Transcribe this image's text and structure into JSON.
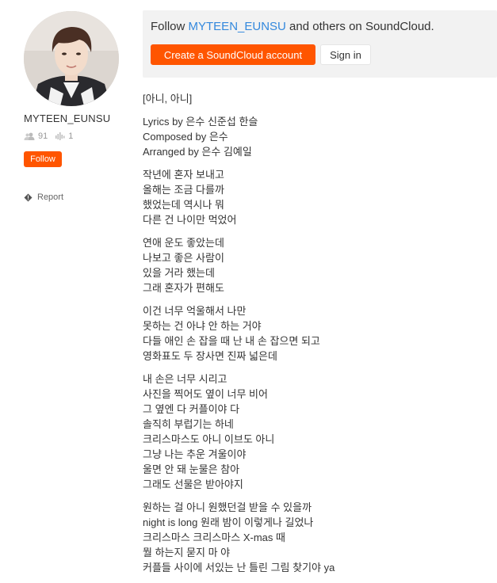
{
  "profile": {
    "username": "MYTEEN_EUNSU",
    "followers": "91",
    "tracks": "1",
    "follow_label": "Follow",
    "report_label": "Report"
  },
  "banner": {
    "prefix": "Follow ",
    "user": "MYTEEN_EUNSU",
    "suffix": " and others on SoundCloud.",
    "create_label": "Create a SoundCloud account",
    "signin_label": "Sign in"
  },
  "colors": {
    "accent": "#ff5500",
    "link": "#3388dd",
    "banner_bg": "#f2f2f2"
  },
  "icons": [
    "followers-icon",
    "tracks-icon",
    "report-flag-icon"
  ],
  "description": [
    [
      "[아니, 아니]"
    ],
    [
      "Lyrics by 은수 신준섭 한슬",
      "Composed by 은수",
      "Arranged by 은수 김예일"
    ],
    [
      "작년에 혼자 보내고",
      "올해는 조금 다를까",
      "했었는데 역시나 뭐",
      "다른 건 나이만 먹었어"
    ],
    [
      "연애 운도 좋았는데",
      "나보고 좋은 사람이",
      "있을 거라 했는데",
      "그래 혼자가 편해도"
    ],
    [
      "이건 너무 억울해서 나만",
      "못하는 건 아냐 안 하는 거야",
      "다들 애인 손 잡을 때 난 내 손 잡으면 되고",
      "영화표도 두 장사면 진짜 넓은데"
    ],
    [
      "내 손은 너무 시리고",
      "사진을 찍어도 옆이 너무 비어",
      "그 옆엔 다 커플이야 다",
      "솔직히 부럽기는 하네",
      "크리스마스도 아니 이브도 아니",
      "그냥 나는 추운 겨울이야",
      "울면 안 돼 눈물은 참아",
      "그래도 선물은 받아야지"
    ],
    [
      "원하는 걸 아니 원했던걸 받을 수 있을까",
      "night is long 원래 밤이 이렇게나 길었나",
      "크리스마스 크리스마스 X-mas 때",
      "뭘 하는지 묻지 마 야",
      "커플들 사이에 서있는 난 틀린 그림 찾기야 ya"
    ]
  ]
}
